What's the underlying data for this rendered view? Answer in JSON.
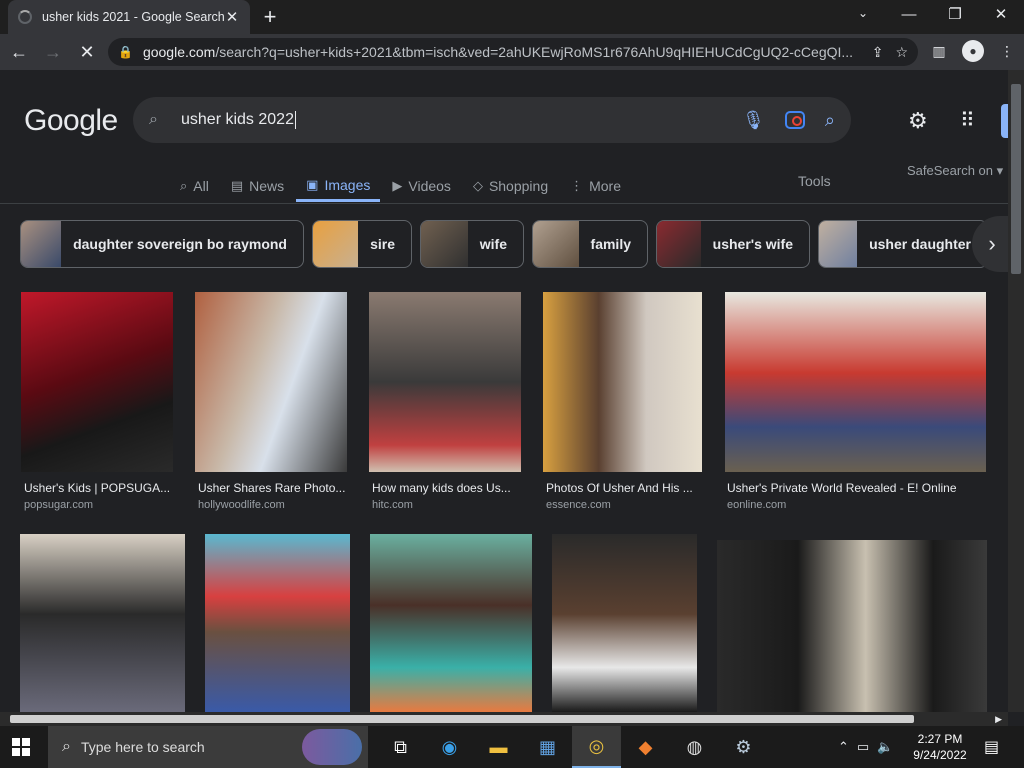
{
  "browser": {
    "tab_title": "usher kids 2021 - Google Search",
    "tab_close": "✕",
    "new_tab": "+",
    "url_domain": "google.com",
    "url_rest": "/search?q=usher+kids+2021&tbm=isch&ved=2ahUKEwjRoMS1r676AhU9qHIEHUCdCgUQ2-cCegQI..."
  },
  "search": {
    "logo": "Google",
    "query": "usher kids 2022"
  },
  "tabs": [
    {
      "label": "All",
      "icon": "search-icon"
    },
    {
      "label": "News",
      "icon": "news-icon"
    },
    {
      "label": "Images",
      "icon": "image-icon"
    },
    {
      "label": "Videos",
      "icon": "video-icon"
    },
    {
      "label": "Shopping",
      "icon": "tag-icon"
    },
    {
      "label": "More",
      "icon": "more-vert-icon"
    }
  ],
  "tools_label": "Tools",
  "safesearch_label": "SafeSearch on",
  "chips": [
    {
      "label": "daughter sovereign bo raymond"
    },
    {
      "label": "sire"
    },
    {
      "label": "wife"
    },
    {
      "label": "family"
    },
    {
      "label": "usher's wife"
    },
    {
      "label": "usher daughter"
    }
  ],
  "results": [
    {
      "caption": "Usher's Kids | POPSUGA...",
      "source": "popsugar.com"
    },
    {
      "caption": "Usher Shares Rare Photo...",
      "source": "hollywoodlife.com"
    },
    {
      "caption": "How many kids does Us...",
      "source": "hitc.com"
    },
    {
      "caption": "Photos Of Usher And His ...",
      "source": "essence.com"
    },
    {
      "caption": "Usher's Private World Revealed - E! Online",
      "source": "eonline.com"
    }
  ],
  "taskbar": {
    "search_placeholder": "Type here to search",
    "time": "2:27 PM",
    "date": "9/24/2022"
  },
  "colors": {
    "accent": "#8ab4f8",
    "background": "#202124"
  }
}
